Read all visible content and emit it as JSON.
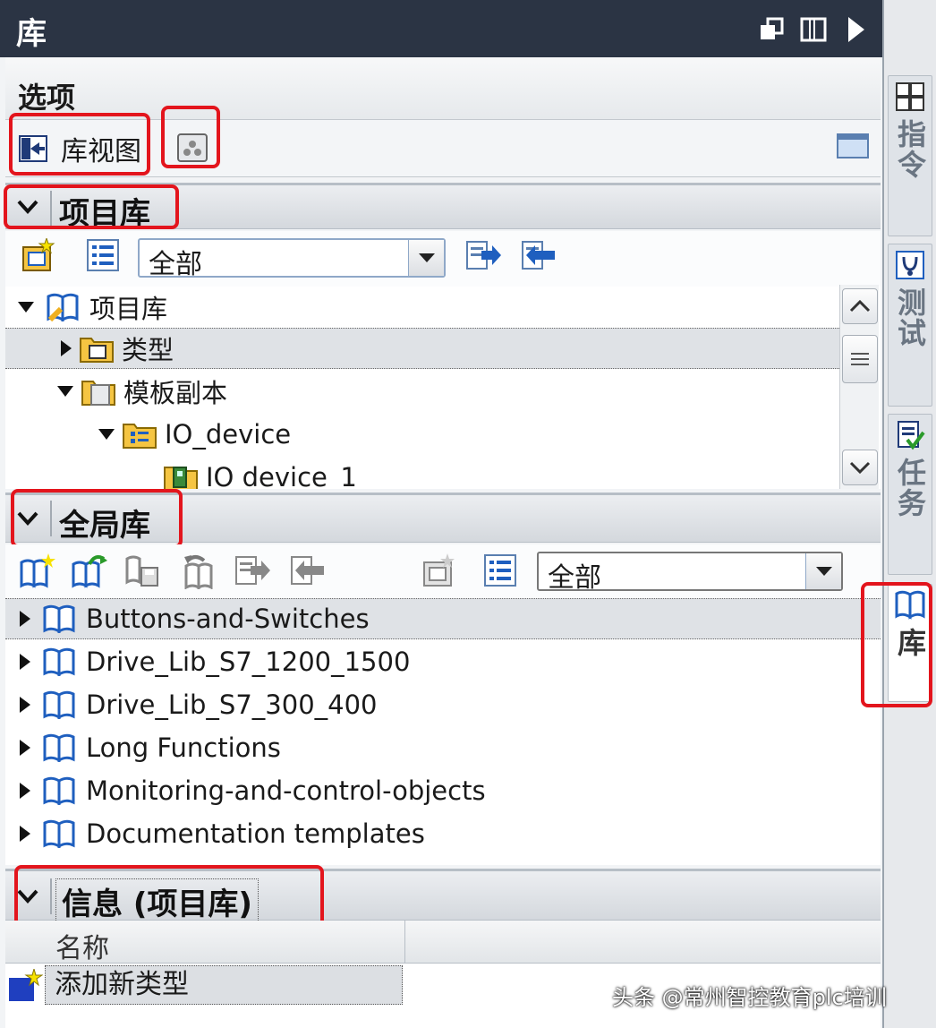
{
  "window": {
    "title": "库"
  },
  "options": {
    "title": "选项",
    "library_view_label": "库视图"
  },
  "project_library": {
    "title": "项目库",
    "filter_value": "全部",
    "tree": [
      {
        "label": "项目库",
        "level": 0,
        "expanded": true
      },
      {
        "label": "类型",
        "level": 1,
        "expanded": false,
        "selected": true
      },
      {
        "label": "模板副本",
        "level": 1,
        "expanded": true
      },
      {
        "label": "IO_device",
        "level": 2,
        "expanded": true
      },
      {
        "label": "IO device_1",
        "level": 3
      }
    ]
  },
  "global_library": {
    "title": "全局库",
    "filter_value": "全部",
    "items": [
      {
        "label": "Buttons-and-Switches",
        "selected": true
      },
      {
        "label": "Drive_Lib_S7_1200_1500"
      },
      {
        "label": "Drive_Lib_S7_300_400"
      },
      {
        "label": "Long Functions"
      },
      {
        "label": "Monitoring-and-control-objects"
      },
      {
        "label": "Documentation templates"
      }
    ]
  },
  "info": {
    "title": "信息 (项目库)",
    "column_name": "名称",
    "row_label": "添加新类型"
  },
  "side_tabs": [
    {
      "label": "指令"
    },
    {
      "label": "测试"
    },
    {
      "label": "任务"
    },
    {
      "label": "库",
      "active": true
    }
  ],
  "watermark": "头条 @常州智控教育plc培训",
  "colors": {
    "titlebar": "#2b3444",
    "highlight": "#e3151d",
    "accent": "#1f5fbf"
  }
}
